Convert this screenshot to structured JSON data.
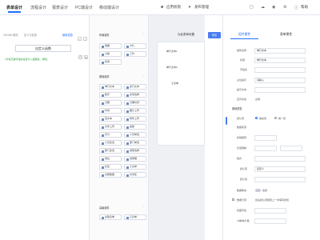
{
  "topbar": {
    "tabs": [
      "表单设计",
      "流程设计",
      "报表设计",
      "PC端设计",
      "移动端设计"
    ],
    "active_tab": 0,
    "actions": [
      "应用权限",
      "发布管理"
    ],
    "help": "帮助"
  },
  "left_panel": {
    "tabs": [
      "100%ile 模块",
      "定义与变量",
      "使用范围"
    ],
    "active_tab": 2,
    "custom_button": "自定义函数",
    "tip": "1字段已被字段的设置计入函数集、规则。"
  },
  "components": {
    "groups": [
      {
        "title": "布局组件",
        "items": [
          "容器",
          "卡片",
          "分组",
          "工作",
          "折叠",
          "标签页",
          "栅格"
        ]
      },
      {
        "title": "基础组件",
        "items": [
          "单行文本",
          "多行文本",
          "数字",
          "多项选择",
          "日期",
          "日期时间",
          "时间",
          "图片上传",
          "富文本",
          "附件上传",
          "文件上传",
          "金额",
          "评分",
          "人员单选",
          "人员多选",
          "部门单选",
          "部门多选",
          "级联选择",
          "地址",
          "选择器",
          "标签",
          "子表单",
          "关联数据",
          "省市区"
        ]
      },
      {
        "title": "高级组件",
        "items": [
          "关联表单",
          "子表单"
        ]
      }
    ],
    "collapse_icon": "chevron-up-icon"
  },
  "canvas": {
    "title": "为此表单设置",
    "preview": "预览",
    "fields": [
      "单行文本1",
      "单行文本2",
      "子表单"
    ]
  },
  "properties": {
    "tabs": [
      "组件属性",
      "表单属性"
    ],
    "active_tab": 0,
    "rows": [
      {
        "label": "组件名称",
        "value": "单行文本"
      },
      {
        "label": "标题",
        "value": "单行文本"
      },
      {
        "label": "字段名",
        "value": ""
      },
      {
        "label": "占位提示",
        "value": "请输入"
      },
      {
        "label": "提示文本",
        "value": ""
      },
      {
        "label": "显示状态",
        "value": "必填"
      }
    ],
    "section_basic": "基础属性",
    "rows2": [
      {
        "label": "默认值",
        "value": ""
      },
      {
        "label": "数据来源",
        "value": ""
      },
      {
        "label": "校验规则",
        "value": ""
      },
      {
        "label": "长度限制",
        "value": ""
      },
      {
        "label": "格式",
        "value": ""
      },
      {
        "label": "默认值",
        "value": "自定义"
      },
      {
        "label": "默认值",
        "value": ""
      }
    ],
    "radio_options": [
      "静态值",
      "统一值"
    ],
    "hint": "您先默认值规则上一步填写的值",
    "rows3": [
      {
        "label": "数据联动",
        "value": "启用"
      },
      {
        "label": "数据计算",
        "value": ""
      },
      {
        "label": "隐藏字段",
        "value": ""
      },
      {
        "label": "JS脚本扩展",
        "value": ""
      }
    ]
  }
}
